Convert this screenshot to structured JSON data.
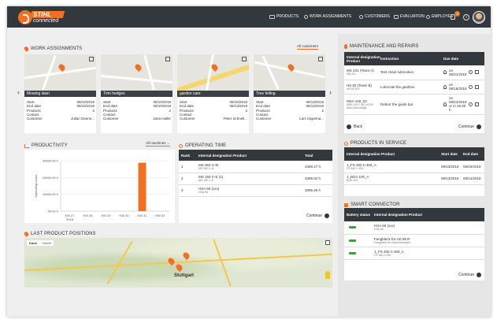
{
  "brand": {
    "name": "STIHL",
    "sub": "connected"
  },
  "nav": [
    "PRODUCTS",
    "WORK ASSIGNMENTS",
    "CUSTOMERS",
    "EVALUATION",
    "EMPLOYEE"
  ],
  "notif_count": "3",
  "work_assignments": {
    "title": "WORK ASSIGNMENTS",
    "filter": "All customers",
    "labels": [
      "Start",
      "End date",
      "Products",
      "Contact",
      "Customer"
    ],
    "cards": [
      {
        "name": "Mowing lawn",
        "start": "08/10/2018",
        "end": "08/10/2018",
        "products": "2",
        "contact": "",
        "customer": "Julian Danne..."
      },
      {
        "name": "Trim hedges",
        "start": "08/10/2018",
        "end": "08/10/2018",
        "products": "2",
        "contact": "",
        "customer": "Jana Haller"
      },
      {
        "name": "garden care",
        "start": "08/10/2018",
        "end": "08/13/2018",
        "products": "2",
        "contact": "",
        "customer": "Peter Schnell..."
      },
      {
        "name": "Tree felling",
        "start": "08/13/2018",
        "end": "08/13/2018",
        "products": "2",
        "contact": "",
        "customer": "Lars Oppema..."
      }
    ]
  },
  "productivity": {
    "title": "PRODUCTIVITY",
    "filter": "All machines",
    "ylabel": "Operating hours",
    "chart_data": {
      "type": "bar",
      "categories": [
        "KW 27 2018",
        "KW 28",
        "KW 29",
        "KW 30",
        "KW 31",
        "KW 32"
      ],
      "values": [
        0,
        0,
        0,
        0,
        28800,
        0
      ],
      "yticks": [
        "30000.00 h",
        "20000.00 h",
        "10000.00 h",
        "00.00 h"
      ],
      "ylim": [
        0,
        30000
      ],
      "ylabel": "Operating hours",
      "colors": {
        "bar": "#f37021"
      }
    }
  },
  "operating_time": {
    "title": "OPERATING TIME",
    "headers": [
      "Rank",
      "Internal designation Product",
      "Total"
    ],
    "rows": [
      {
        "rank": "1",
        "name": "MS 362 C-M",
        "sub": "MS 362 C-M",
        "total": "3469.27 h"
      },
      {
        "rank": "2",
        "name": "MS 150 C-E (1)",
        "sub": "MS 150 C-E",
        "total": "3395.92 h"
      },
      {
        "rank": "3",
        "name": "HSA 56 (xxx)",
        "sub": "HSA 56",
        "total": "3095.46 h"
      }
    ],
    "continue": "Continue"
  },
  "positions": {
    "title": "LAST PRODUCT POSITIONS",
    "map_tabs": [
      "Karte",
      "Satellit"
    ],
    "city": "Stuttgart"
  },
  "maintenance": {
    "title": "MAINTENANCE AND REPAIRS",
    "headers": [
      "Internal designation Product",
      "Instruction",
      "Due date"
    ],
    "rows": [
      {
        "name": "MS 231 (Team A)",
        "sub": "MS 231",
        "instr": "Test chain lubrication",
        "due": "on 08/21/2018"
      },
      {
        "name": "HS 82 (Team B)",
        "sub": "HS 82 R-E",
        "instr": "Lubricate the gearbox",
        "due": "on 08/16/2018"
      },
      {
        "name": "MSA 120_03",
        "sub": "MSA 120 C-BQ HSVP Akku-Motorsäge",
        "instr": "Deburr the guide bar",
        "due": "on 08/24/2018 or in 25.00 h"
      }
    ],
    "back": "Back",
    "continue": "Continue"
  },
  "in_service": {
    "title": "PRODUCTS IN SERVICE",
    "headers": [
      "Internal designation Product",
      "Start date",
      "End date"
    ],
    "rows": [
      {
        "name": "1_FS 460 C-EM_A",
        "sub": "FS 460 C-EM",
        "start": "08/13/2018",
        "end": "08/15/2018"
      },
      {
        "name": "1_BGA 100_A",
        "sub": "BGA 100",
        "start": "08/13/2018",
        "end": "08/14/2018"
      }
    ]
  },
  "smart_connector": {
    "title": "SMART CONNECTOR",
    "headers": [
      "Battery status",
      "Internal designation Product"
    ],
    "rows": [
      {
        "name": "HSA 56 (xxx)",
        "sub": "HSA 56"
      },
      {
        "name": "Fangbleck für HS 86 R",
        "sub": "Fangbleck für Schneidmesser"
      },
      {
        "name": "1_FS 460 C-EM_A",
        "sub": "FS 460 C-EM"
      }
    ],
    "continue": "Continue"
  }
}
